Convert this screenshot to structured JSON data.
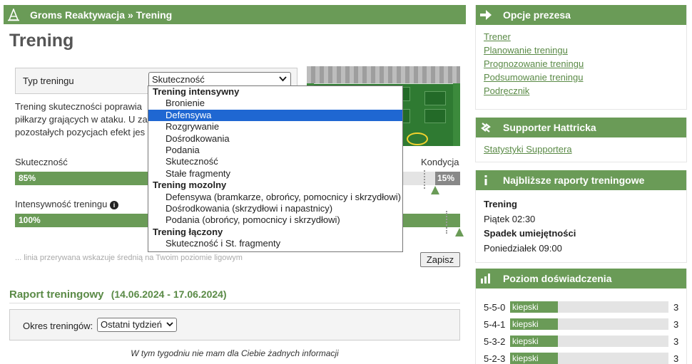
{
  "header": {
    "breadcrumb": "Groms Reaktywacja » Trening"
  },
  "page_title": "Trening",
  "training_type": {
    "label": "Typ treningu",
    "selected": "Skuteczność",
    "description_lines": [
      "Trening skuteczności poprawia",
      "piłkarzy grających w ataku. U za",
      "pozostałych pozycjach efekt jes"
    ]
  },
  "dropdown": {
    "groups": [
      {
        "label": "Trening intensywny",
        "options": [
          "Bronienie",
          "Defensywa",
          "Rozgrywanie",
          "Dośrodkowania",
          "Podania",
          "Skuteczność",
          "Stałe fragmenty"
        ]
      },
      {
        "label": "Trening mozolny",
        "options": [
          "Defensywa (bramkarze, obrońcy, pomocnicy i skrzydłowi)",
          "Dośrodkowania (skrzydłowi i napastnicy)",
          "Podania (obrońcy, pomocnicy i skrzydłowi)"
        ]
      },
      {
        "label": "Trening łączony",
        "options": [
          "Skuteczność i St. fragmenty"
        ]
      }
    ],
    "highlighted": "Defensywa"
  },
  "bars": {
    "skutecznosc": {
      "label": "Skuteczność",
      "value": "85%",
      "fraction": 0.85
    },
    "kondycja": {
      "label": "Kondycja",
      "value": "15%"
    },
    "intensywnosc": {
      "label": "Intensywność treningu",
      "value": "100%",
      "fraction": 1.0
    }
  },
  "note": "... linia przerywana wskazuje średnią na Twoim poziomie ligowym",
  "save_button": "Zapisz",
  "report": {
    "title": "Raport treningowy",
    "dates": "(14.06.2024 - 17.06.2024)",
    "period_label": "Okres treningów:",
    "period_selected": "Ostatni tydzień",
    "empty_message": "W tym tygodniu nie mam dla Ciebie żadnych informacji"
  },
  "sidebar": {
    "opcje": {
      "title": "Opcje prezesa",
      "links": [
        "Trener",
        "Planowanie treningu",
        "Prognozowanie treningu",
        "Podsumowanie treningu",
        "Podręcznik"
      ]
    },
    "supporter": {
      "title": "Supporter Hattricka",
      "link": "Statystyki Supportera"
    },
    "raporty": {
      "title": "Najbliższe raporty treningowe",
      "t1": "Trening",
      "d1": "Piątek 02:30",
      "t2": "Spadek umiejętności",
      "d2": "Poniedziałek 09:00"
    },
    "doswiadczenie": {
      "title": "Poziom doświadczenia",
      "rows": [
        {
          "formation": "5-5-0",
          "level": "kiepski",
          "value": "3"
        },
        {
          "formation": "5-4-1",
          "level": "kiepski",
          "value": "3"
        },
        {
          "formation": "5-3-2",
          "level": "kiepski",
          "value": "3"
        },
        {
          "formation": "5-2-3",
          "level": "kiepski",
          "value": "3"
        }
      ]
    }
  },
  "colors": {
    "accent": "#6a9b57",
    "link": "#5a8a46",
    "highlight": "#1f67d2"
  },
  "icons": [
    "training-cone-icon",
    "arrow-right-icon",
    "supporter-icon",
    "info-icon",
    "bar-chart-icon",
    "chevron-down-icon"
  ]
}
